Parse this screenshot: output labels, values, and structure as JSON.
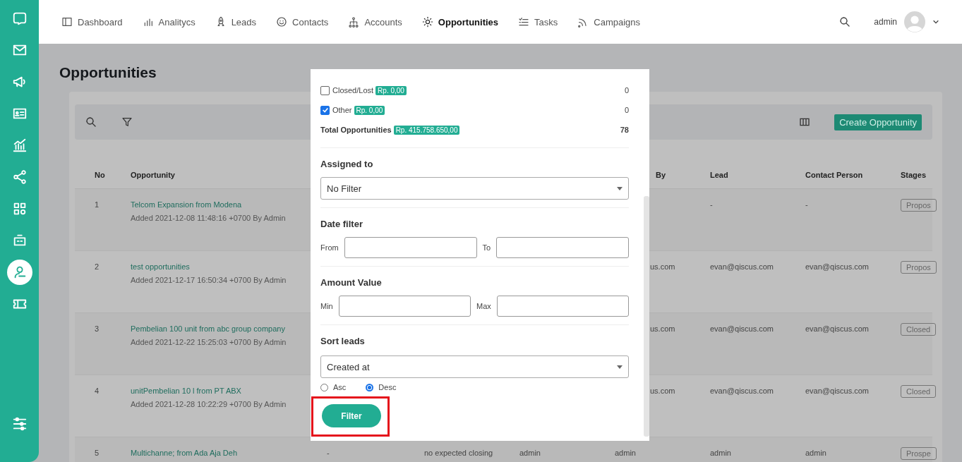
{
  "sidebar": {
    "items": [
      {
        "selected": false
      },
      {
        "selected": false
      },
      {
        "selected": false
      },
      {
        "selected": false
      },
      {
        "selected": false
      },
      {
        "selected": false
      },
      {
        "selected": false
      },
      {
        "selected": false
      },
      {
        "selected": true
      },
      {
        "selected": false
      }
    ]
  },
  "top_nav": {
    "items": [
      {
        "label": "Dashboard",
        "selected": false
      },
      {
        "label": "Analitycs",
        "selected": false
      },
      {
        "label": "Leads",
        "selected": false
      },
      {
        "label": "Contacts",
        "selected": false
      },
      {
        "label": "Accounts",
        "selected": false
      },
      {
        "label": "Opportunities",
        "selected": true
      },
      {
        "label": "Tasks",
        "selected": false
      },
      {
        "label": "Campaigns",
        "selected": false
      }
    ],
    "user": {
      "name": "admin"
    }
  },
  "page": {
    "title": "Opportunities"
  },
  "toolbar": {
    "create_button": "Create Opportunity"
  },
  "table": {
    "columns": [
      "No",
      "Opportunity",
      "By",
      "Lead",
      "Contact Person",
      "Stages"
    ],
    "rows": [
      {
        "no": "1",
        "title": "Telcom Expansion from Modena",
        "added": "Added 2021-12-08 11:48:16 +0700 By Admin",
        "lead": "-",
        "contact": "-",
        "stage": "Propos"
      },
      {
        "no": "2",
        "title": "test opportunities",
        "added": "Added 2021-12-17 16:50:34 +0700 By Admin",
        "by": "us.com",
        "lead": "evan@qiscus.com",
        "contact": "evan@qiscus.com",
        "stage": "Propos"
      },
      {
        "no": "3",
        "title": "Pembelian 100 unit from abc group company",
        "added": "Added 2021-12-22 15:25:03 +0700 By Admin",
        "by": "us.com",
        "lead": "evan@qiscus.com",
        "contact": "evan@qiscus.com",
        "stage": "Closed"
      },
      {
        "no": "4",
        "title": "unitPembelian 10 l from PT ABX",
        "added": "Added 2021-12-28 10:22:29 +0700 By Admin",
        "by": "us.com",
        "lead": "evan@qiscus.com",
        "contact": "evan@qiscus.com",
        "stage": "Closed"
      },
      {
        "no": "5",
        "title": "Multichanne; from Ada Aja Deh",
        "column_3": "-",
        "column_4": "no expected closing",
        "column_5": "admin",
        "by": "admin",
        "lead": "admin",
        "contact": "admin",
        "stage": "Prospe"
      }
    ]
  },
  "filter_dialog": {
    "status_rows": [
      {
        "label": "Closed/Lost",
        "amount": "Rp. 0,00",
        "count": "0",
        "checked": false
      },
      {
        "label": "Other",
        "amount": "Rp. 0,00",
        "count": "0",
        "checked": true
      }
    ],
    "total": {
      "label": "Total Opportunities",
      "amount": "Rp. 415.758.650,00",
      "count": "78"
    },
    "assigned_to": {
      "title": "Assigned to",
      "value": "No Filter"
    },
    "date_filter": {
      "title": "Date filter",
      "from_label": "From",
      "to_label": "To"
    },
    "amount_value": {
      "title": "Amount Value",
      "min_label": "Min",
      "max_label": "Max"
    },
    "sort": {
      "title": "Sort leads",
      "value": "Created at",
      "orders": [
        {
          "label": "Asc",
          "selected": false
        },
        {
          "label": "Desc",
          "selected": true
        }
      ]
    },
    "filter_button": {
      "label": "Filter",
      "highlighted": true
    }
  }
}
